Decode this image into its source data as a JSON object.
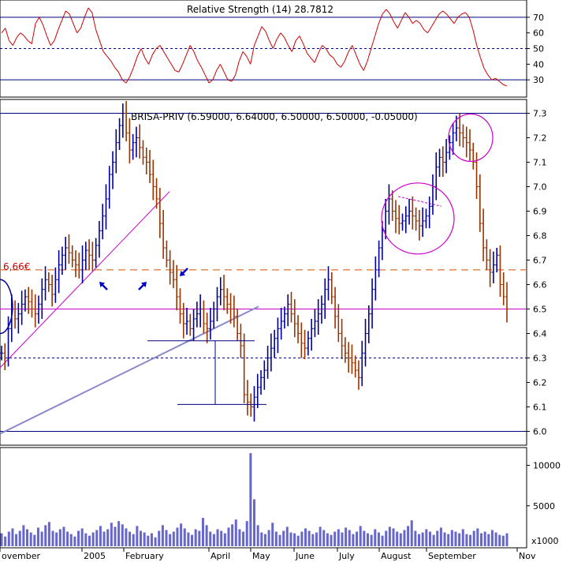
{
  "chart_data": [
    {
      "type": "line",
      "panel": "rsi",
      "title": "Relative Strength (14) 28.7812",
      "ylim": [
        20,
        80
      ],
      "yticks": [
        30,
        40,
        50,
        60,
        70
      ],
      "reference_lines": [
        30,
        50,
        70
      ],
      "colors": {
        "line": "#cc0000",
        "ref": "#000080"
      },
      "series": [
        {
          "values": [
            60,
            63,
            55,
            52,
            57,
            60,
            58,
            55,
            53,
            66,
            70,
            65,
            58,
            52,
            55,
            62,
            68,
            74,
            72,
            66,
            60,
            63,
            70,
            76,
            73,
            62,
            55,
            48,
            45,
            42,
            38,
            35,
            30,
            28,
            32,
            38,
            45,
            50,
            44,
            40,
            46,
            50,
            52,
            48,
            44,
            40,
            36,
            35,
            40,
            46,
            52,
            48,
            42,
            38,
            33,
            28,
            30,
            36,
            40,
            35,
            30,
            29,
            33,
            42,
            48,
            45,
            40,
            52,
            58,
            64,
            61,
            55,
            50,
            56,
            60,
            57,
            52,
            48,
            55,
            58,
            53,
            47,
            44,
            41,
            47,
            52,
            50,
            46,
            44,
            40,
            38,
            42,
            48,
            52,
            46,
            40,
            36,
            42,
            50,
            58,
            66,
            72,
            75,
            72,
            67,
            63,
            68,
            73,
            70,
            66,
            68,
            66,
            62,
            60,
            64,
            68,
            72,
            74,
            72,
            69,
            66,
            70,
            72,
            73,
            70,
            62,
            52,
            44,
            37,
            33,
            30,
            31,
            29,
            27,
            26
          ]
        }
      ]
    },
    {
      "type": "line",
      "panel": "price",
      "title": "BRISA-PRIV (6.59000, 6.64000, 6.50000, 6.50000, -0.05000)",
      "ylim": [
        5.95,
        7.35
      ],
      "yticks": [
        6.0,
        6.1,
        6.2,
        6.3,
        6.4,
        6.5,
        6.6,
        6.7,
        6.8,
        6.9,
        7.0,
        7.1,
        7.2,
        7.3
      ],
      "xlabels": [
        "ovember",
        "2005",
        "February",
        "April",
        "May",
        "June",
        "July",
        "August",
        "September",
        "Nov"
      ],
      "annotations": [
        {
          "text": "6,66€",
          "value": 6.66
        }
      ],
      "colors": {
        "bar_up": "#000099",
        "bar_down": "#993300",
        "support": "#cc00cc",
        "level": "#e07030",
        "trend": "#8888cc",
        "circle": "#cc00cc",
        "arrow": "#0000cc",
        "box": "#000080"
      },
      "series": [
        {
          "name": "close",
          "values": [
            6.32,
            6.3,
            6.42,
            6.5,
            6.46,
            6.48,
            6.52,
            6.55,
            6.53,
            6.5,
            6.48,
            6.52,
            6.58,
            6.62,
            6.6,
            6.56,
            6.62,
            6.68,
            6.72,
            6.75,
            6.73,
            6.7,
            6.68,
            6.66,
            6.7,
            6.74,
            6.72,
            6.7,
            6.76,
            6.82,
            6.88,
            6.95,
            7.05,
            7.1,
            7.18,
            7.25,
            7.3,
            7.22,
            7.15,
            7.18,
            7.2,
            7.16,
            7.12,
            7.1,
            7.05,
            7.0,
            6.95,
            6.85,
            6.75,
            6.7,
            6.65,
            6.62,
            6.55,
            6.48,
            6.44,
            6.45,
            6.42,
            6.46,
            6.48,
            6.5,
            6.44,
            6.42,
            6.45,
            6.5,
            6.55,
            6.58,
            6.55,
            6.52,
            6.5,
            6.47,
            6.4,
            6.35,
            6.15,
            6.12,
            6.1,
            6.14,
            6.18,
            6.22,
            6.25,
            6.3,
            6.34,
            6.38,
            6.42,
            6.45,
            6.48,
            6.52,
            6.48,
            6.44,
            6.4,
            6.36,
            6.34,
            6.38,
            6.42,
            6.45,
            6.48,
            6.52,
            6.58,
            6.62,
            6.55,
            6.47,
            6.4,
            6.35,
            6.32,
            6.3,
            6.28,
            6.25,
            6.22,
            6.32,
            6.4,
            6.48,
            6.58,
            6.66,
            6.75,
            6.82,
            6.9,
            6.95,
            6.9,
            6.87,
            6.85,
            6.86,
            6.88,
            6.9,
            6.88,
            6.86,
            6.84,
            6.86,
            6.88,
            6.92,
            7.0,
            7.08,
            7.12,
            7.1,
            7.14,
            7.18,
            7.22,
            7.24,
            7.22,
            7.2,
            7.18,
            7.15,
            7.1,
            7.0,
            6.85,
            6.75,
            6.7,
            6.65,
            6.68,
            6.72,
            6.6,
            6.55,
            6.5
          ]
        }
      ]
    },
    {
      "type": "bar",
      "panel": "volume",
      "yticks": [
        5000,
        10000
      ],
      "ylim": [
        0,
        12000
      ],
      "unit_label": "x1000",
      "colors": {
        "bar": "#6666cc"
      },
      "series": [
        {
          "values": [
            1600,
            1200,
            1800,
            2200,
            1500,
            1900,
            2600,
            2100,
            1700,
            1400,
            2300,
            1800,
            2600,
            3000,
            1900,
            1700,
            2100,
            2400,
            1800,
            1500,
            1200,
            1900,
            2200,
            1600,
            1300,
            1700,
            2000,
            2500,
            1800,
            2100,
            2900,
            2400,
            3100,
            2700,
            2200,
            1800,
            1500,
            2500,
            1900,
            1700,
            1300,
            1600,
            1100,
            1900,
            2600,
            2000,
            1500,
            1800,
            2300,
            2800,
            2200,
            1700,
            1400,
            2100,
            1900,
            3500,
            2600,
            1800,
            1500,
            2100,
            1900,
            1600,
            2300,
            2700,
            3300,
            2100,
            1800,
            3100,
            11500,
            5800,
            2600,
            1700,
            1500,
            2000,
            2900,
            1800,
            1400,
            1900,
            2400,
            1700,
            1600,
            1300,
            1800,
            2200,
            1900,
            1500,
            1700,
            2400,
            2000,
            1600,
            1400,
            1800,
            2100,
            1700,
            2300,
            2000,
            1500,
            1800,
            2500,
            1900,
            1600,
            1400,
            2100,
            1700,
            1300,
            1900,
            2400,
            2200,
            1800,
            1600,
            2000,
            2500,
            3200,
            1900,
            1500,
            1700,
            2100,
            1800,
            1400,
            1900,
            2300,
            1700,
            1500,
            2000,
            1800,
            1600,
            2100,
            1500,
            1400,
            1900,
            2200,
            1600,
            1800,
            1500,
            2000,
            1700,
            1400,
            1300,
            1600
          ]
        }
      ]
    }
  ]
}
